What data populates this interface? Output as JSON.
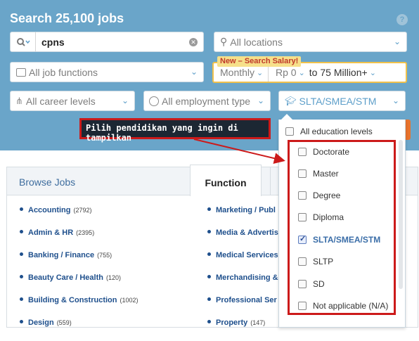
{
  "search": {
    "title": "Search 25,100 jobs",
    "help_label": "?",
    "keyword_value": "cpns",
    "location_placeholder": "All locations",
    "function_placeholder": "All job functions",
    "salary_badge": "New – Search Salary!",
    "salary_period": "Monthly",
    "salary_from": "Rp 0",
    "salary_to": "to 75 Million+",
    "career_placeholder": "All career levels",
    "employment_placeholder": "All employment type",
    "education_selected": "SLTA/SMEA/STM"
  },
  "annotation": {
    "text": "Pilih pendidikan yang ingin di tampilkan"
  },
  "education_dropdown": {
    "all_label": "All education levels",
    "options": [
      {
        "label": "Doctorate",
        "checked": false
      },
      {
        "label": "Master",
        "checked": false
      },
      {
        "label": "Degree",
        "checked": false
      },
      {
        "label": "Diploma",
        "checked": false
      },
      {
        "label": "SLTA/SMEA/STM",
        "checked": true
      },
      {
        "label": "SLTP",
        "checked": false
      },
      {
        "label": "SD",
        "checked": false
      },
      {
        "label": "Not applicable (N/A)",
        "checked": false
      }
    ]
  },
  "browse": {
    "title": "Browse Jobs",
    "active_tab": "Function",
    "left_column": [
      {
        "name": "Accounting",
        "count": "(2792)"
      },
      {
        "name": "Admin & HR",
        "count": "(2395)"
      },
      {
        "name": "Banking / Finance",
        "count": "(755)"
      },
      {
        "name": "Beauty Care / Health",
        "count": "(120)"
      },
      {
        "name": "Building & Construction",
        "count": "(1002)"
      },
      {
        "name": "Design",
        "count": "(559)"
      }
    ],
    "right_column": [
      {
        "name": "Marketing / Publ",
        "count": ""
      },
      {
        "name": "Media & Advertis",
        "count": ""
      },
      {
        "name": "Medical Services",
        "count": ""
      },
      {
        "name": "Merchandising &",
        "count": ""
      },
      {
        "name": "Professional Ser",
        "count": ""
      },
      {
        "name": "Property",
        "count": "(147)"
      }
    ]
  },
  "colors": {
    "panel": "#6aa5c9",
    "accent": "#5c9ec9",
    "annotation_border": "#cc1a1a",
    "salary_border": "#f0c14b"
  }
}
